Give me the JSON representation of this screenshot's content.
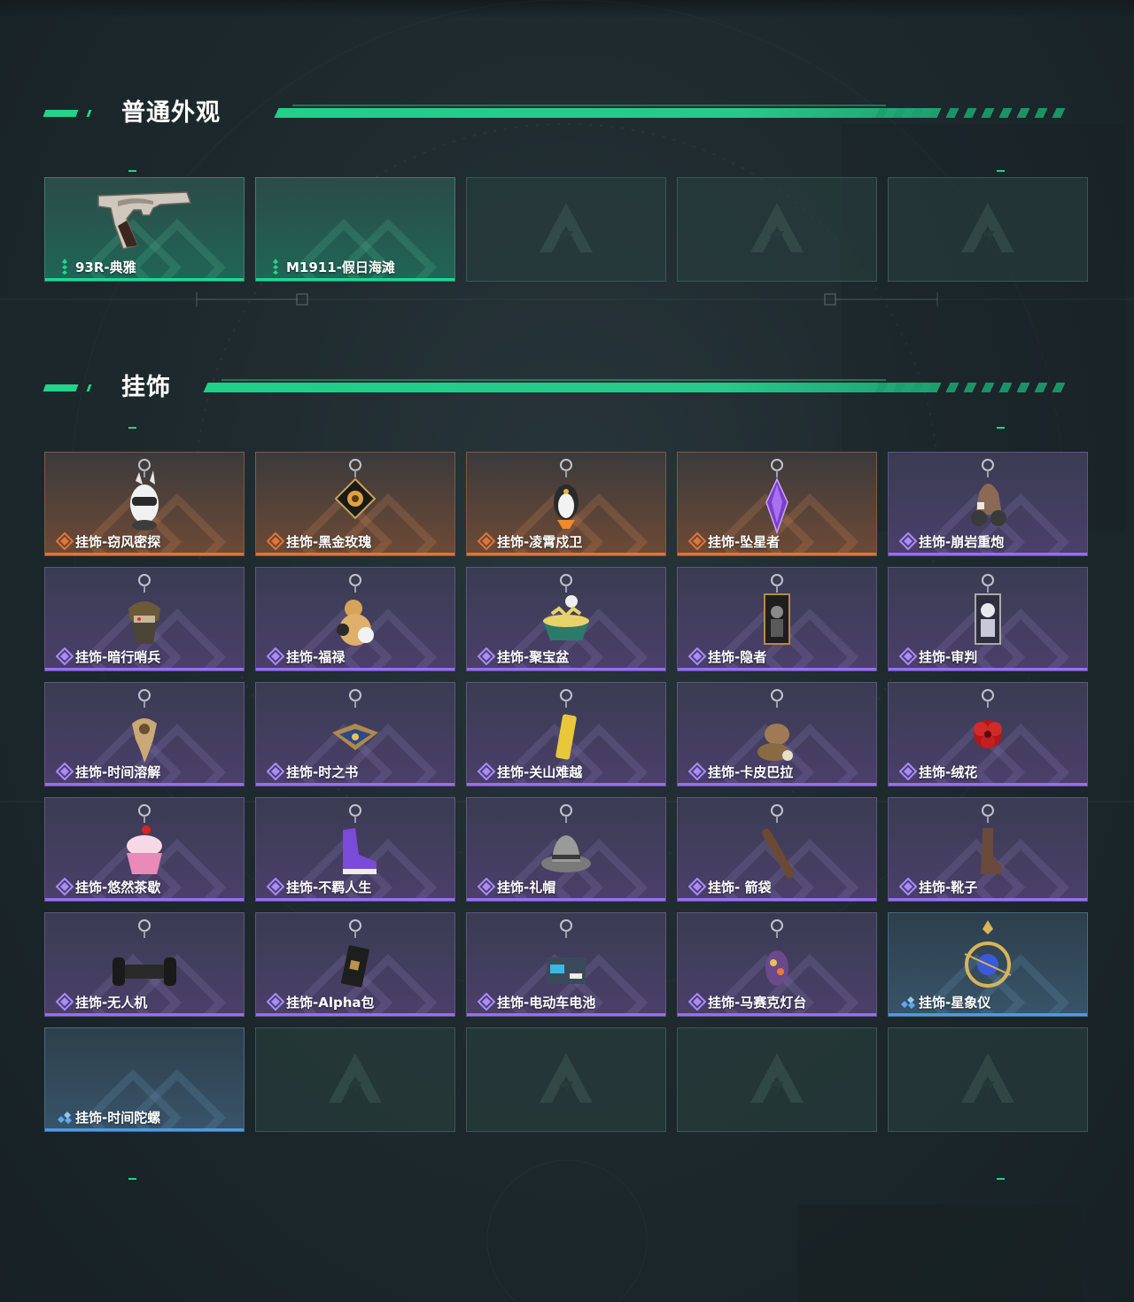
{
  "colors": {
    "accent": "#23d38a",
    "gold_bar": "#e0753a",
    "purple_bar": "#9a6cff",
    "blue_bar": "#4c9be8",
    "green_bar": "#1ed98c"
  },
  "sections": {
    "skins": {
      "title": "普通外观",
      "items": [
        {
          "label": "93R-典雅",
          "rarity": "green",
          "icon": "pistol-icon"
        },
        {
          "label": "M1911-假日海滩",
          "rarity": "green",
          "icon": ""
        },
        {
          "label": "",
          "rarity": "empty",
          "icon": "logo-icon"
        },
        {
          "label": "",
          "rarity": "empty",
          "icon": "logo-icon"
        },
        {
          "label": "",
          "rarity": "empty",
          "icon": "logo-icon"
        }
      ]
    },
    "charms": {
      "title": "挂饰",
      "items": [
        {
          "label": "挂饰-窃风密探",
          "rarity": "gold",
          "icon": "rabbit-charm-icon"
        },
        {
          "label": "挂饰-黑金玫瑰",
          "rarity": "gold",
          "icon": "black-rose-charm-icon"
        },
        {
          "label": "挂饰-凌霄戍卫",
          "rarity": "gold",
          "icon": "penguin-charm-icon"
        },
        {
          "label": "挂饰-坠星者",
          "rarity": "gold",
          "icon": "crystal-charm-icon"
        },
        {
          "label": "挂饰-崩岩重炮",
          "rarity": "purple",
          "icon": "cannon-charm-icon"
        },
        {
          "label": "挂饰-暗行哨兵",
          "rarity": "purple",
          "icon": "sentinel-charm-icon"
        },
        {
          "label": "挂饰-福禄",
          "rarity": "purple",
          "icon": "gourd-charm-icon"
        },
        {
          "label": "挂饰-聚宝盆",
          "rarity": "purple",
          "icon": "treasure-bowl-charm-icon"
        },
        {
          "label": "挂饰-隐者",
          "rarity": "purple",
          "icon": "tarot-hermit-charm-icon"
        },
        {
          "label": "挂饰-审判",
          "rarity": "purple",
          "icon": "tarot-judgement-charm-icon"
        },
        {
          "label": "挂饰-时间溶解",
          "rarity": "purple",
          "icon": "melting-clock-charm-icon"
        },
        {
          "label": "挂饰-时之书",
          "rarity": "purple",
          "icon": "book-charm-icon"
        },
        {
          "label": "挂饰-关山难越",
          "rarity": "purple",
          "icon": "gold-bar-charm-icon"
        },
        {
          "label": "挂饰-卡皮巴拉",
          "rarity": "purple",
          "icon": "capybara-charm-icon"
        },
        {
          "label": "挂饰-绒花",
          "rarity": "purple",
          "icon": "red-flower-charm-icon"
        },
        {
          "label": "挂饰-悠然茶歇",
          "rarity": "purple",
          "icon": "cupcake-charm-icon"
        },
        {
          "label": "挂饰-不羁人生",
          "rarity": "purple",
          "icon": "sneaker-charm-icon"
        },
        {
          "label": "挂饰-礼帽",
          "rarity": "purple",
          "icon": "hat-charm-icon"
        },
        {
          "label": "挂饰- 箭袋",
          "rarity": "purple",
          "icon": "quiver-charm-icon"
        },
        {
          "label": "挂饰-靴子",
          "rarity": "purple",
          "icon": "boot-charm-icon"
        },
        {
          "label": "挂饰-无人机",
          "rarity": "purple",
          "icon": "drone-charm-icon"
        },
        {
          "label": "挂饰-Alpha包",
          "rarity": "purple",
          "icon": "bag-charm-icon"
        },
        {
          "label": "挂饰-电动车电池",
          "rarity": "purple",
          "icon": "battery-charm-icon"
        },
        {
          "label": "挂饰-马赛克灯台",
          "rarity": "purple",
          "icon": "lamp-charm-icon"
        },
        {
          "label": "挂饰-星象仪",
          "rarity": "blue",
          "icon": "astrolabe-charm-icon"
        },
        {
          "label": "挂饰-时间陀螺",
          "rarity": "blue",
          "icon": ""
        },
        {
          "label": "",
          "rarity": "empty",
          "icon": "logo-icon"
        },
        {
          "label": "",
          "rarity": "empty",
          "icon": "logo-icon"
        },
        {
          "label": "",
          "rarity": "empty",
          "icon": "logo-icon"
        },
        {
          "label": "",
          "rarity": "empty",
          "icon": "logo-icon"
        }
      ]
    }
  }
}
